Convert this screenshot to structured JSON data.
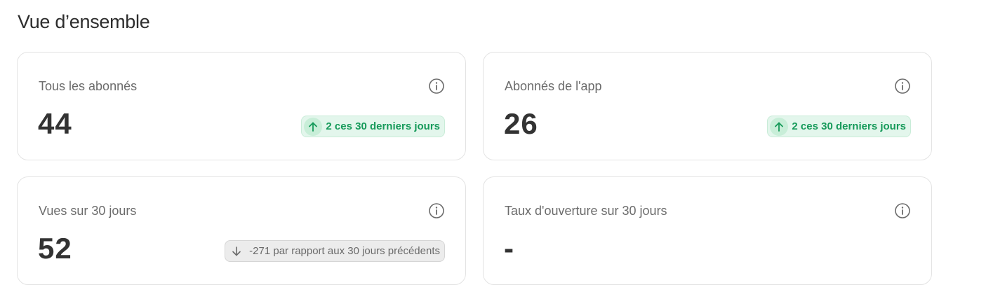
{
  "page": {
    "title": "Vue d’ensemble"
  },
  "cards": [
    {
      "label": "Tous les abonnés",
      "value": "44",
      "trend": {
        "direction": "up",
        "text": "2 ces 30 derniers jours"
      }
    },
    {
      "label": "Abonnés de l'app",
      "value": "26",
      "trend": {
        "direction": "up",
        "text": "2 ces 30 derniers jours"
      }
    },
    {
      "label": "Vues sur 30 jours",
      "value": "52",
      "trend": {
        "direction": "down",
        "text": "-271 par rapport aux 30 jours précédents"
      }
    },
    {
      "label": "Taux d'ouverture sur 30 jours",
      "value": "-"
    }
  ],
  "icons": {
    "info": "info-circle-icon",
    "trend_up": "arrow-up-icon",
    "trend_down": "arrow-down-icon"
  },
  "colors": {
    "trend_up_text": "#169a5a",
    "trend_up_bg": "#e3f6ec",
    "trend_down_text": "#6a6a6a",
    "trend_down_bg": "#ececec",
    "card_border": "#e3e3e3"
  }
}
